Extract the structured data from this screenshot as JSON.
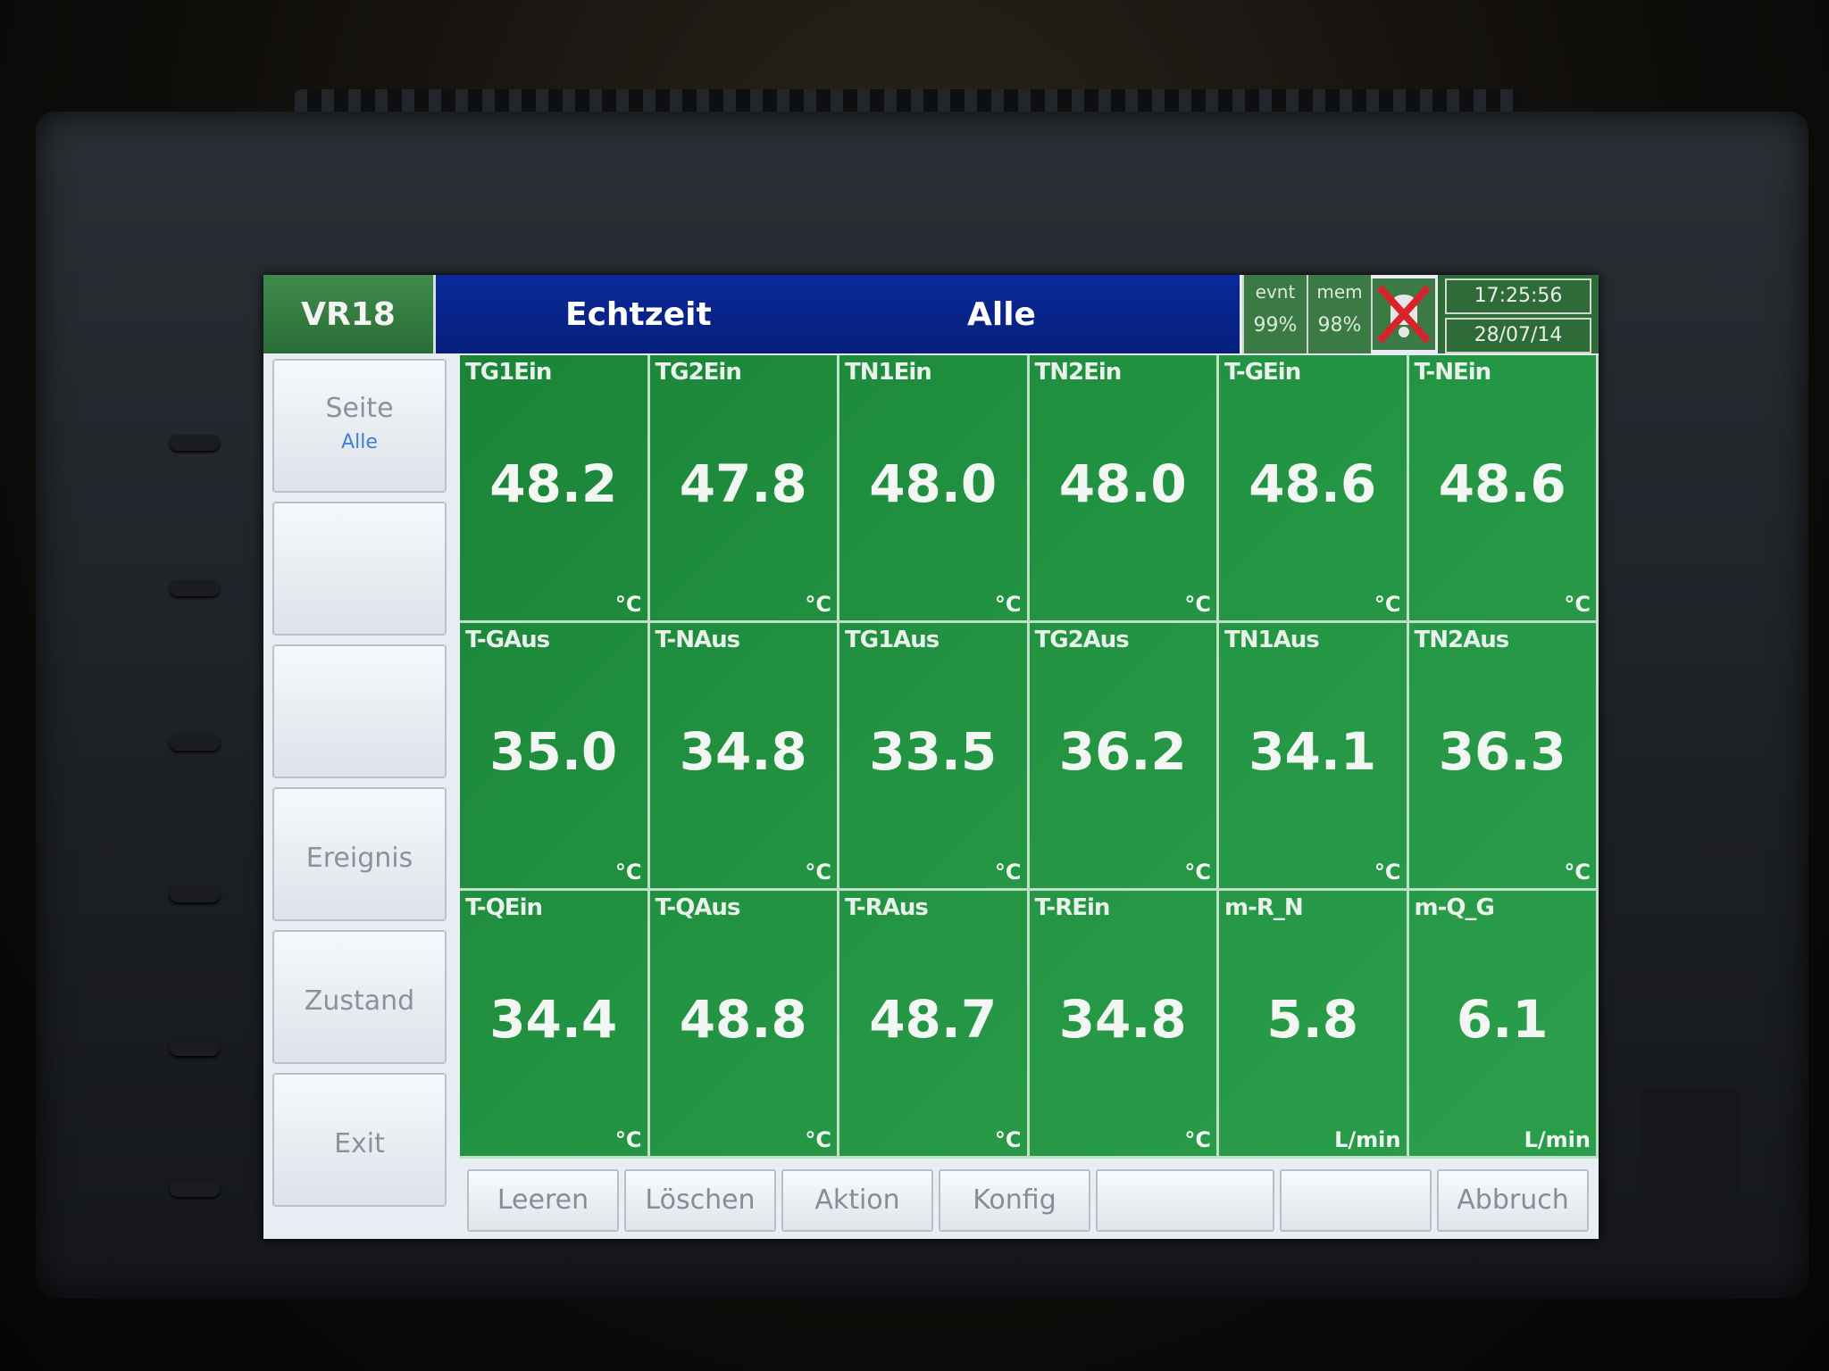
{
  "header": {
    "device": "VR18",
    "mode": "Echtzeit",
    "page": "Alle",
    "evnt_label": "evnt",
    "evnt_value": "99%",
    "mem_label": "mem",
    "mem_value": "98%",
    "time": "17:25:56",
    "date": "28/07/14"
  },
  "sidebar": {
    "page_label": "Seite",
    "page_value": "Alle",
    "event_label": "Ereignis",
    "status_label": "Zustand",
    "exit_label": "Exit"
  },
  "channels": [
    {
      "tag": "TG1Ein",
      "value": "48.2",
      "unit": "°C"
    },
    {
      "tag": "TG2Ein",
      "value": "47.8",
      "unit": "°C"
    },
    {
      "tag": "TN1Ein",
      "value": "48.0",
      "unit": "°C"
    },
    {
      "tag": "TN2Ein",
      "value": "48.0",
      "unit": "°C"
    },
    {
      "tag": "T-GEin",
      "value": "48.6",
      "unit": "°C"
    },
    {
      "tag": "T-NEin",
      "value": "48.6",
      "unit": "°C"
    },
    {
      "tag": "T-GAus",
      "value": "35.0",
      "unit": "°C"
    },
    {
      "tag": "T-NAus",
      "value": "34.8",
      "unit": "°C"
    },
    {
      "tag": "TG1Aus",
      "value": "33.5",
      "unit": "°C"
    },
    {
      "tag": "TG2Aus",
      "value": "36.2",
      "unit": "°C"
    },
    {
      "tag": "TN1Aus",
      "value": "34.1",
      "unit": "°C"
    },
    {
      "tag": "TN2Aus",
      "value": "36.3",
      "unit": "°C"
    },
    {
      "tag": "T-QEin",
      "value": "34.4",
      "unit": "°C"
    },
    {
      "tag": "T-QAus",
      "value": "48.8",
      "unit": "°C"
    },
    {
      "tag": "T-RAus",
      "value": "48.7",
      "unit": "°C"
    },
    {
      "tag": "T-REin",
      "value": "34.8",
      "unit": "°C"
    },
    {
      "tag": "m-R_N",
      "value": "5.8",
      "unit": "L/min"
    },
    {
      "tag": "m-Q_G",
      "value": "6.1",
      "unit": "L/min"
    }
  ],
  "toolbar": {
    "clear": "Leeren",
    "delete": "Löschen",
    "action": "Aktion",
    "config": "Konfig",
    "cancel": "Abbruch"
  },
  "colors": {
    "tile_green": "#2aa34c",
    "header_blue": "#0b2a9a",
    "device_green": "#3f8a4b"
  }
}
